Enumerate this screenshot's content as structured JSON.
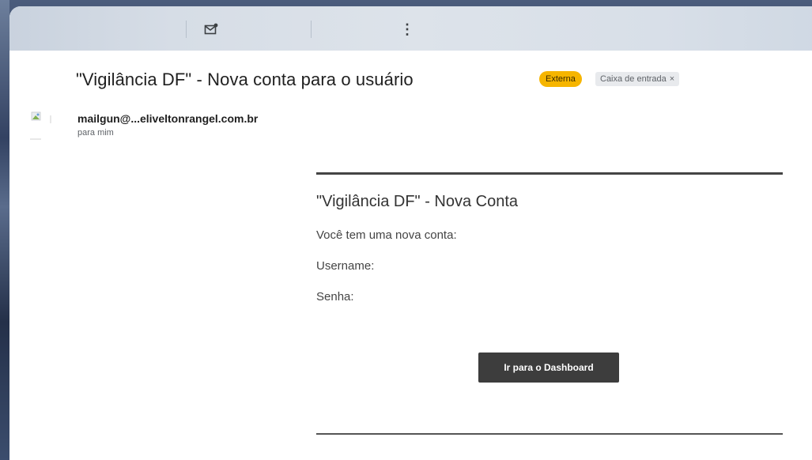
{
  "email": {
    "subject": "\"Vigilância DF\" - Nova conta para o usuário",
    "labels": {
      "external": "Externa",
      "inbox": "Caixa de entrada",
      "inbox_remove": "×"
    },
    "sender": "mailgun@...eliveltonrangel.com.br",
    "recipient": "para mim"
  },
  "body": {
    "title": "\"Vigilância DF\" - Nova Conta",
    "intro": "Você tem uma nova conta:",
    "username_label": "Username:",
    "password_label": "Senha:",
    "cta_label": "Ir para o Dashboard"
  },
  "toolbar": {
    "icons": [
      "mark-unread-icon",
      "more-vert-icon"
    ],
    "more_glyph": "⋮"
  },
  "colors": {
    "external_badge": "#f6b500",
    "cta_background": "#3d3d3d"
  }
}
